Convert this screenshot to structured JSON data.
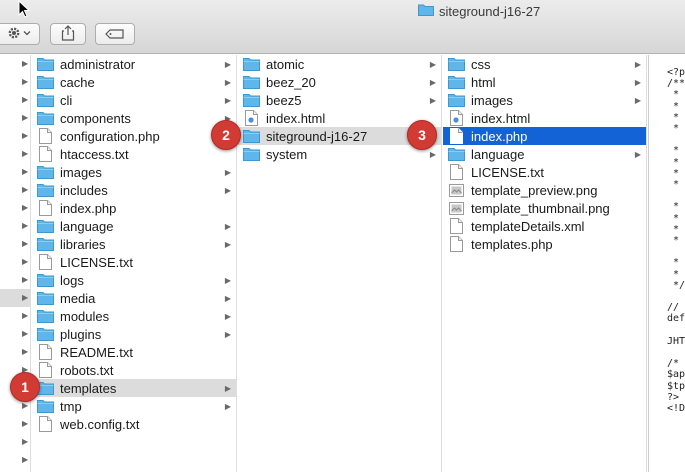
{
  "window": {
    "title": "siteground-j16-27"
  },
  "toolbar": {
    "action_icon": "gear-icon",
    "share_icon": "share-icon",
    "tag_icon": "tag-icon"
  },
  "column1": [
    {
      "label": "administrator",
      "type": "folder"
    },
    {
      "label": "cache",
      "type": "folder"
    },
    {
      "label": "cli",
      "type": "folder"
    },
    {
      "label": "components",
      "type": "folder"
    },
    {
      "label": "configuration.php",
      "type": "file"
    },
    {
      "label": "htaccess.txt",
      "type": "file"
    },
    {
      "label": "images",
      "type": "folder"
    },
    {
      "label": "includes",
      "type": "folder"
    },
    {
      "label": "index.php",
      "type": "file"
    },
    {
      "label": "language",
      "type": "folder"
    },
    {
      "label": "libraries",
      "type": "folder"
    },
    {
      "label": "LICENSE.txt",
      "type": "file"
    },
    {
      "label": "logs",
      "type": "folder"
    },
    {
      "label": "media",
      "type": "folder"
    },
    {
      "label": "modules",
      "type": "folder"
    },
    {
      "label": "plugins",
      "type": "folder"
    },
    {
      "label": "README.txt",
      "type": "file"
    },
    {
      "label": "robots.txt",
      "type": "file"
    },
    {
      "label": "templates",
      "type": "folder"
    },
    {
      "label": "tmp",
      "type": "folder"
    },
    {
      "label": "web.config.txt",
      "type": "file"
    }
  ],
  "column2": [
    {
      "label": "atomic",
      "type": "folder"
    },
    {
      "label": "beez_20",
      "type": "folder"
    },
    {
      "label": "beez5",
      "type": "folder"
    },
    {
      "label": "index.html",
      "type": "html"
    },
    {
      "label": "siteground-j16-27",
      "type": "folder"
    },
    {
      "label": "system",
      "type": "folder"
    }
  ],
  "column3": [
    {
      "label": "css",
      "type": "folder"
    },
    {
      "label": "html",
      "type": "folder"
    },
    {
      "label": "images",
      "type": "folder"
    },
    {
      "label": "index.html",
      "type": "html"
    },
    {
      "label": "index.php",
      "type": "file"
    },
    {
      "label": "language",
      "type": "folder"
    },
    {
      "label": "LICENSE.txt",
      "type": "file"
    },
    {
      "label": "template_preview.png",
      "type": "image"
    },
    {
      "label": "template_thumbnail.png",
      "type": "image"
    },
    {
      "label": "templateDetails.xml",
      "type": "file"
    },
    {
      "label": "templates.php",
      "type": "file"
    }
  ],
  "badges": [
    "1",
    "2",
    "3"
  ],
  "preview_lines": [
    "<?p",
    "/**",
    " *",
    " *",
    " *",
    " *",
    "",
    " *",
    " *",
    " *",
    " *",
    "",
    " *",
    " *",
    " *",
    " *",
    "",
    " *",
    " *",
    " */",
    "",
    "// ",
    "def",
    "",
    "JHT",
    "",
    "/*",
    "$ap",
    "$tp",
    "?>",
    "<!D"
  ],
  "colors": {
    "selection_blue": "#1463d6",
    "selection_gray": "#dcdcdc",
    "folder_blue": "#5fb6ea",
    "badge_red": "#d13b34"
  }
}
